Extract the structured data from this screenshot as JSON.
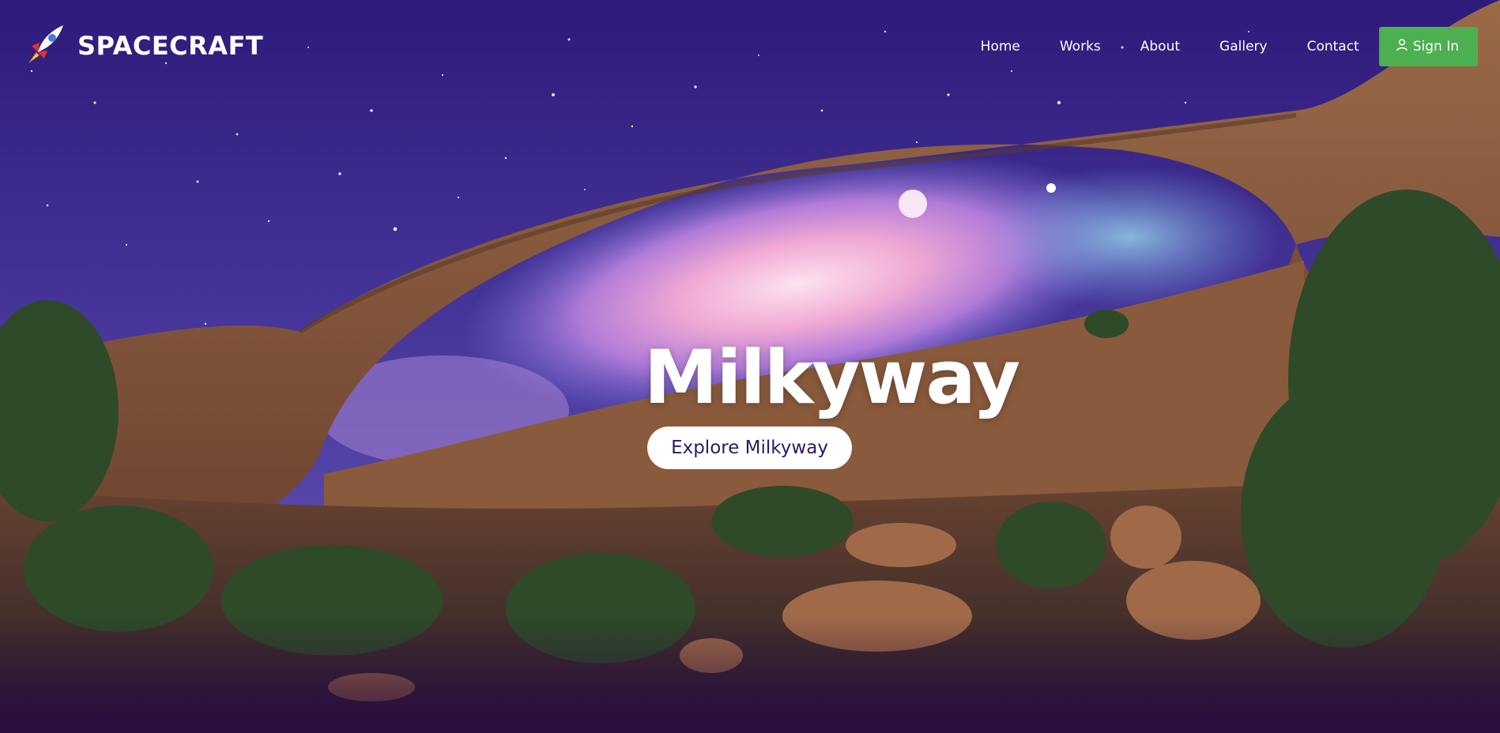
{
  "brand": {
    "name": "SPACECRAFT",
    "logo_icon": "rocket-icon"
  },
  "nav": {
    "items": [
      {
        "label": "Home"
      },
      {
        "label": "Works"
      },
      {
        "label": "About"
      },
      {
        "label": "Gallery"
      },
      {
        "label": "Contact"
      }
    ],
    "signin_label": "Sign In",
    "signin_icon": "user-icon",
    "signin_color": "#4caf50"
  },
  "hero": {
    "title": "Milkyway",
    "cta_label": "Explore Milkyway"
  },
  "colors": {
    "sky": "#3b2a8c",
    "rock": "#8a5a3c",
    "cta_text": "#2c1a63"
  }
}
